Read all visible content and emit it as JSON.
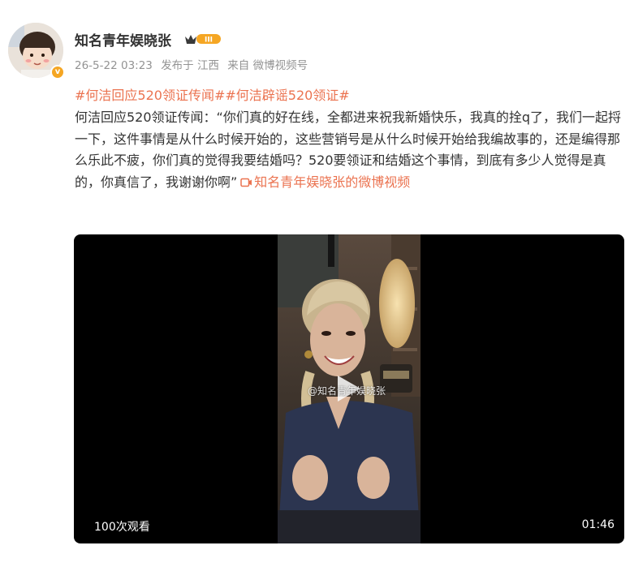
{
  "post": {
    "author": {
      "name": "知名青年娱晓张",
      "avatar_icon": "avatar-cartoon-child",
      "verified_icon": "verified-badge-icon",
      "vip_badge": "III",
      "vip_icon": "crown-icon"
    },
    "meta": {
      "timestamp": "26-5-22 03:23",
      "location": "发布于 江西",
      "source": "来自 微博视频号"
    },
    "topics": [
      "#何洁回应520领证传闻#",
      "#何洁辟谣520领证#"
    ],
    "text": "何洁回应520领证传闻：“你们真的好在线，全都进来祝我新婚快乐，我真的拴q了，我们一起捋一下，这件事情是从什么时候开始的，这些营销号是从什么时候开始给我编故事的，还是编得那么乐此不疲，你们真的觉得我要结婚吗？520要领证和结婚这个事情，到底有多少人觉得是真的，你真信了，我谢谢你啊”",
    "video_link_label": "知名青年娱晓张的微博视频",
    "video": {
      "watermark": "@知名青年娱晓张",
      "view_count": "100次观看",
      "duration": "01:46"
    }
  },
  "colors": {
    "accent": "#eb7350",
    "text": "#333333",
    "meta": "#939393",
    "vip_gold": "#f5a623"
  }
}
